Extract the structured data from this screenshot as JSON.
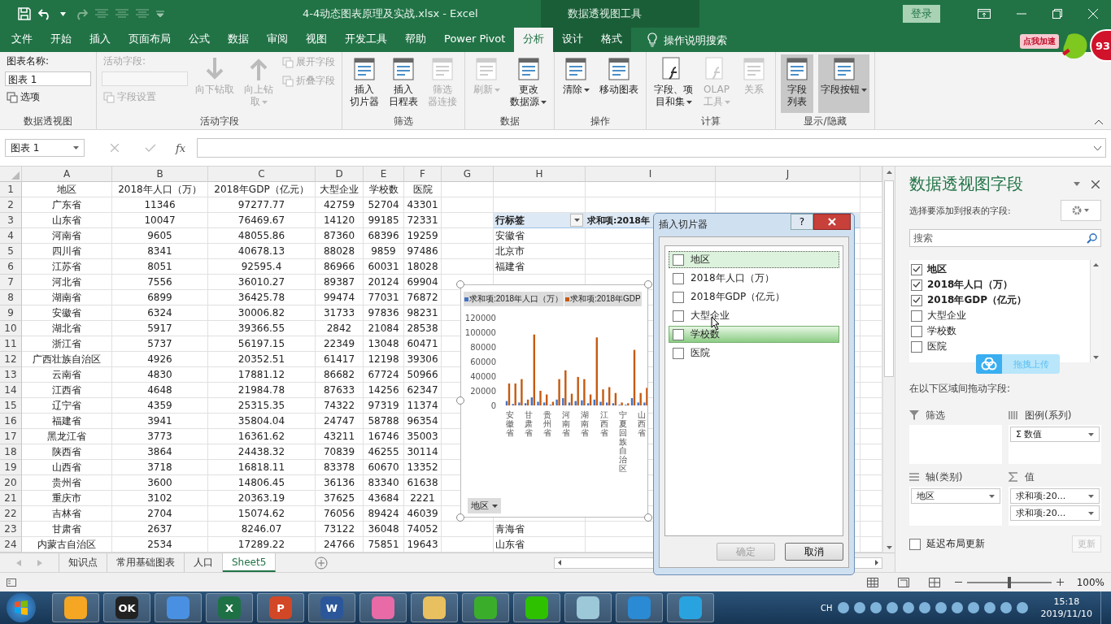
{
  "title_bar": {
    "title": "4-4动态图表原理及实战.xlsx  -  Excel",
    "context": "数据透视图工具",
    "sign_in": "登录"
  },
  "speed_badge": {
    "label": "点我加速",
    "count": "93"
  },
  "menu_tabs": [
    {
      "label": "文件",
      "selected": false
    },
    {
      "label": "开始",
      "selected": false
    },
    {
      "label": "插入",
      "selected": false
    },
    {
      "label": "页面布局",
      "selected": false
    },
    {
      "label": "公式",
      "selected": false
    },
    {
      "label": "数据",
      "selected": false
    },
    {
      "label": "审阅",
      "selected": false
    },
    {
      "label": "视图",
      "selected": false
    },
    {
      "label": "开发工具",
      "selected": false
    },
    {
      "label": "帮助",
      "selected": false
    },
    {
      "label": "Power Pivot",
      "selected": false
    },
    {
      "label": "分析",
      "selected": true
    },
    {
      "label": "设计",
      "selected": false
    },
    {
      "label": "格式",
      "selected": false
    }
  ],
  "tell_me": "操作说明搜索",
  "ribbon_groups": [
    {
      "name": "数据透视图",
      "columns": [
        [
          {
            "kind": "label",
            "label": "图表名称:",
            "disabled": false
          },
          {
            "kind": "input",
            "value": "图表 1",
            "disabled": false
          },
          {
            "kind": "small",
            "label": "选项",
            "disabled": false
          }
        ]
      ]
    },
    {
      "name": "活动字段",
      "columns": [
        [
          {
            "kind": "label",
            "label": "活动字段:",
            "disabled": true
          },
          {
            "kind": "input",
            "disabled": true
          },
          {
            "kind": "small",
            "label": "字段设置",
            "disabled": true
          }
        ],
        [
          {
            "kind": "large",
            "lines": [
              "向下钻取"
            ],
            "disabled": true,
            "pressed": false,
            "dropdown": false
          }
        ],
        [
          {
            "kind": "large",
            "lines": [
              "向上钻",
              "取"
            ],
            "disabled": true,
            "pressed": false,
            "dropdown": true
          }
        ],
        [
          {
            "kind": "small",
            "label": "展开字段",
            "disabled": true
          },
          {
            "kind": "small",
            "label": "折叠字段",
            "disabled": true
          }
        ]
      ]
    },
    {
      "name": "筛选",
      "columns": [
        [
          {
            "kind": "large",
            "lines": [
              "插入",
              "切片器"
            ],
            "disabled": false,
            "pressed": false,
            "dropdown": false
          }
        ],
        [
          {
            "kind": "large",
            "lines": [
              "插入",
              "日程表"
            ],
            "disabled": false,
            "pressed": false,
            "dropdown": false
          }
        ],
        [
          {
            "kind": "large",
            "lines": [
              "筛选",
              "器连接"
            ],
            "disabled": true,
            "pressed": false,
            "dropdown": false
          }
        ]
      ]
    },
    {
      "name": "数据",
      "columns": [
        [
          {
            "kind": "large",
            "lines": [
              "刷新"
            ],
            "disabled": true,
            "pressed": false,
            "dropdown": true
          }
        ],
        [
          {
            "kind": "large",
            "lines": [
              "更改",
              "数据源"
            ],
            "disabled": false,
            "pressed": false,
            "dropdown": true
          }
        ]
      ]
    },
    {
      "name": "操作",
      "columns": [
        [
          {
            "kind": "large",
            "lines": [
              "清除"
            ],
            "disabled": false,
            "pressed": false,
            "dropdown": true
          }
        ],
        [
          {
            "kind": "large",
            "lines": [
              "移动图表"
            ],
            "disabled": false,
            "pressed": false,
            "dropdown": false
          }
        ]
      ]
    },
    {
      "name": "计算",
      "columns": [
        [
          {
            "kind": "large",
            "lines": [
              "字段、项",
              "目和集"
            ],
            "disabled": false,
            "pressed": false,
            "dropdown": true
          }
        ],
        [
          {
            "kind": "large",
            "lines": [
              "OLAP",
              "工具"
            ],
            "disabled": true,
            "pressed": false,
            "dropdown": true
          }
        ],
        [
          {
            "kind": "large",
            "lines": [
              "关系"
            ],
            "disabled": true,
            "pressed": false,
            "dropdown": false
          }
        ]
      ]
    },
    {
      "name": "显示/隐藏",
      "columns": [
        [
          {
            "kind": "large",
            "lines": [
              "字段",
              "列表"
            ],
            "disabled": false,
            "pressed": true,
            "dropdown": false
          }
        ],
        [
          {
            "kind": "large",
            "lines": [
              "字段按钮"
            ],
            "disabled": false,
            "pressed": true,
            "dropdown": true
          }
        ]
      ]
    }
  ],
  "formula_bar": {
    "name_box": "图表 1",
    "fx": "fx"
  },
  "columns": [
    "A",
    "B",
    "C",
    "D",
    "E",
    "F",
    "G",
    "H",
    "I",
    "J"
  ],
  "rows": [
    {
      "num": "1",
      "cells": [
        "地区",
        "2018年人口（万）",
        "2018年GDP（亿元）",
        "大型企业",
        "学校数",
        "医院"
      ]
    },
    {
      "num": "2",
      "cells": [
        "广东省",
        "11346",
        "97277.77",
        "42759",
        "52704",
        "43301"
      ]
    },
    {
      "num": "3",
      "cells": [
        "山东省",
        "10047",
        "76469.67",
        "14120",
        "99185",
        "72331"
      ],
      "pivot_label": "行标签",
      "pivot_header": true,
      "pivot_value": "求和项:2018年"
    },
    {
      "num": "4",
      "cells": [
        "河南省",
        "9605",
        "48055.86",
        "87360",
        "68396",
        "19259"
      ],
      "pivot_label": "安徽省",
      "pivot_header": false
    },
    {
      "num": "5",
      "cells": [
        "四川省",
        "8341",
        "40678.13",
        "88028",
        "9859",
        "97486"
      ],
      "pivot_label": "北京市",
      "pivot_header": false
    },
    {
      "num": "6",
      "cells": [
        "江苏省",
        "8051",
        "92595.4",
        "86966",
        "60031",
        "18028"
      ],
      "pivot_label": "福建省",
      "pivot_header": false
    },
    {
      "num": "7",
      "cells": [
        "河北省",
        "7556",
        "36010.27",
        "89387",
        "20124",
        "69904"
      ]
    },
    {
      "num": "8",
      "cells": [
        "湖南省",
        "6899",
        "36425.78",
        "99474",
        "77031",
        "76872"
      ]
    },
    {
      "num": "9",
      "cells": [
        "安徽省",
        "6324",
        "30006.82",
        "31733",
        "97836",
        "98231"
      ]
    },
    {
      "num": "10",
      "cells": [
        "湖北省",
        "5917",
        "39366.55",
        "2842",
        "21084",
        "28538"
      ]
    },
    {
      "num": "11",
      "cells": [
        "浙江省",
        "5737",
        "56197.15",
        "22349",
        "13048",
        "60471"
      ]
    },
    {
      "num": "12",
      "cells": [
        "广西壮族自治区",
        "4926",
        "20352.51",
        "61417",
        "12198",
        "39306"
      ]
    },
    {
      "num": "13",
      "cells": [
        "云南省",
        "4830",
        "17881.12",
        "86682",
        "67724",
        "50966"
      ]
    },
    {
      "num": "14",
      "cells": [
        "江西省",
        "4648",
        "21984.78",
        "87633",
        "14256",
        "62347"
      ]
    },
    {
      "num": "15",
      "cells": [
        "辽宁省",
        "4359",
        "25315.35",
        "74322",
        "97319",
        "11374"
      ]
    },
    {
      "num": "16",
      "cells": [
        "福建省",
        "3941",
        "35804.04",
        "24747",
        "58788",
        "96354"
      ]
    },
    {
      "num": "17",
      "cells": [
        "黑龙江省",
        "3773",
        "16361.62",
        "43211",
        "16746",
        "35003"
      ]
    },
    {
      "num": "18",
      "cells": [
        "陕西省",
        "3864",
        "24438.32",
        "70839",
        "46255",
        "30114"
      ]
    },
    {
      "num": "19",
      "cells": [
        "山西省",
        "3718",
        "16818.11",
        "83378",
        "60670",
        "13352"
      ]
    },
    {
      "num": "20",
      "cells": [
        "贵州省",
        "3600",
        "14806.45",
        "36136",
        "83340",
        "61638"
      ]
    },
    {
      "num": "21",
      "cells": [
        "重庆市",
        "3102",
        "20363.19",
        "37625",
        "43684",
        "2221"
      ]
    },
    {
      "num": "22",
      "cells": [
        "吉林省",
        "2704",
        "15074.62",
        "76056",
        "89424",
        "46039"
      ]
    },
    {
      "num": "23",
      "cells": [
        "甘肃省",
        "2637",
        "8246.07",
        "73122",
        "36048",
        "74052"
      ],
      "pivot_label": "青海省",
      "pivot_header": false
    },
    {
      "num": "24",
      "cells": [
        "内蒙古自治区",
        "2534",
        "17289.22",
        "24766",
        "75851",
        "19643"
      ],
      "pivot_label": "山东省",
      "pivot_header": false
    }
  ],
  "chart": {
    "axis_button": "地区",
    "chart_data": {
      "type": "bar",
      "stacked": false,
      "legend": "top",
      "categories": [
        "安徽省",
        null,
        null,
        "甘肃省",
        null,
        null,
        "贵州省",
        null,
        null,
        "河南省",
        null,
        null,
        "湖南省",
        null,
        null,
        "江西省",
        null,
        null,
        "宁夏回族自治区",
        null,
        null,
        "山西省",
        null
      ],
      "ylim": [
        0,
        120000
      ],
      "yticks": [
        0,
        20000,
        40000,
        60000,
        80000,
        100000,
        120000
      ],
      "series": [
        {
          "name": "求和项:2018年人口（万）",
          "color": "#4472c4",
          "values": [
            6000,
            2000,
            4000,
            3000,
            11000,
            5000,
            4000,
            1000,
            8000,
            10000,
            4000,
            6000,
            7000,
            3000,
            8000,
            5000,
            4000,
            3000,
            1000,
            1000,
            10000,
            4000,
            4000
          ]
        },
        {
          "name": "求和项:2018年GDP",
          "color": "#c55a11",
          "values": [
            30000,
            30000,
            36000,
            8000,
            97000,
            20000,
            15000,
            5000,
            36000,
            48000,
            16000,
            39000,
            36000,
            15000,
            93000,
            22000,
            25000,
            17000,
            4000,
            3000,
            76000,
            17000,
            24000
          ]
        }
      ]
    }
  },
  "dialog": {
    "title": "插入切片器",
    "help": "?",
    "fields": [
      {
        "label": "地区",
        "checked": false,
        "focused": true,
        "hovered": false
      },
      {
        "label": "2018年人口（万）",
        "checked": false,
        "focused": false,
        "hovered": false
      },
      {
        "label": "2018年GDP（亿元）",
        "checked": false,
        "focused": false,
        "hovered": false
      },
      {
        "label": "大型企业",
        "checked": false,
        "focused": false,
        "hovered": false
      },
      {
        "label": "学校数",
        "checked": false,
        "focused": false,
        "hovered": true
      },
      {
        "label": "医院",
        "checked": false,
        "focused": false,
        "hovered": false
      }
    ],
    "buttons": [
      {
        "label": "确定",
        "disabled": true
      },
      {
        "label": "取消",
        "disabled": false
      }
    ]
  },
  "pane": {
    "title": "数据透视图字段",
    "subtitle": "选择要添加到报表的字段:",
    "search_placeholder": "搜索",
    "fields": [
      {
        "label": "地区",
        "checked": true
      },
      {
        "label": "2018年人口（万）",
        "checked": true
      },
      {
        "label": "2018年GDP（亿元）",
        "checked": true
      },
      {
        "label": "大型企业",
        "checked": false
      },
      {
        "label": "学校数",
        "checked": false
      },
      {
        "label": "医院",
        "checked": false
      }
    ],
    "upload_badge": "拖拽上传",
    "areas_label": "在以下区域间拖动字段:",
    "areas": [
      {
        "kind": "filter",
        "title": "筛选"
      },
      {
        "kind": "legend",
        "title": "图例(系列)",
        "items": [
          "Σ 数值"
        ]
      },
      {
        "kind": "axis",
        "title": "轴(类别)",
        "items": [
          "地区"
        ]
      },
      {
        "kind": "values",
        "title": "值",
        "items": [
          "求和项:20...",
          "求和项:20..."
        ]
      }
    ],
    "defer": {
      "label": "延迟布局更新",
      "checked": false
    },
    "update": {
      "label": "更新",
      "disabled": true
    }
  },
  "sheet_tabs": [
    {
      "label": "知识点",
      "selected": false
    },
    {
      "label": "常用基础图表",
      "selected": false
    },
    {
      "label": "人口",
      "selected": false
    },
    {
      "label": "Sheet5",
      "selected": true
    }
  ],
  "status_bar": {
    "zoom": "100%",
    "level": 0.5
  },
  "taskbar": {
    "apps": [
      {
        "kind": "ring"
      },
      {
        "kind": "okeye",
        "label": "OK"
      },
      {
        "kind": "bird"
      },
      {
        "kind": "sheet",
        "label": "X"
      },
      {
        "kind": "slides",
        "label": "P"
      },
      {
        "kind": "doc",
        "label": "W"
      },
      {
        "kind": "cam"
      },
      {
        "kind": "folder"
      },
      {
        "kind": "browser"
      },
      {
        "kind": "chat"
      },
      {
        "kind": "note"
      },
      {
        "kind": "globe"
      },
      {
        "kind": "play"
      }
    ],
    "ime": "CH",
    "time": "15:18",
    "date": "2019/11/10"
  }
}
